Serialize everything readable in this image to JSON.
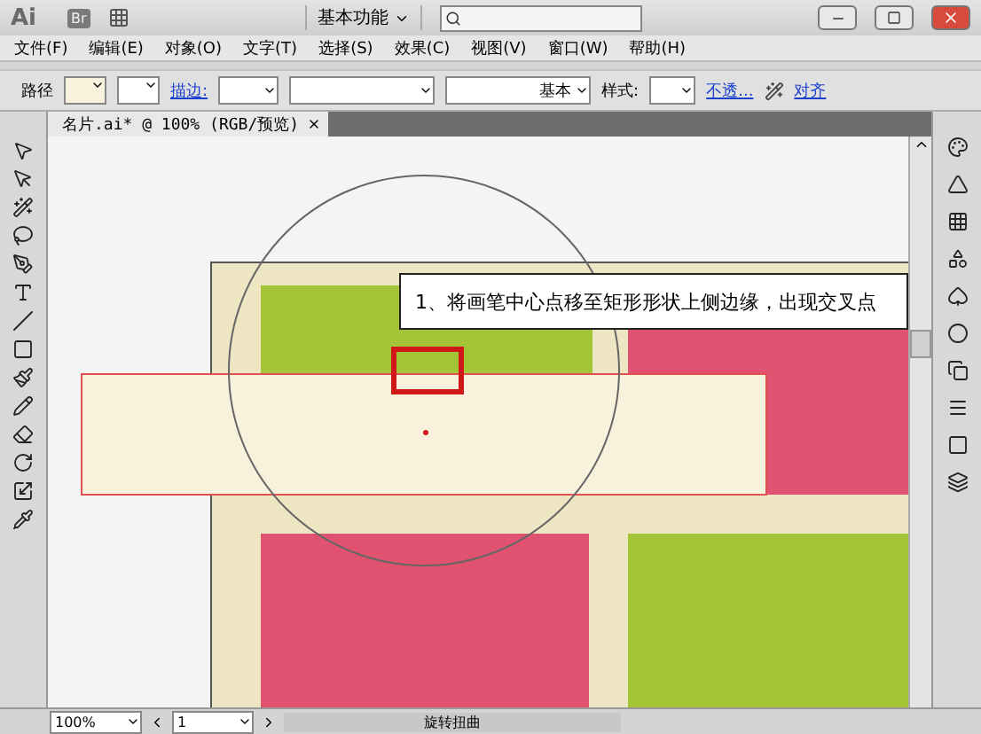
{
  "title_bar": {
    "app_logo": "Ai",
    "bridge": "Br",
    "workspace": "基本功能"
  },
  "menu": [
    "文件(F)",
    "编辑(E)",
    "对象(O)",
    "文字(T)",
    "选择(S)",
    "效果(C)",
    "视图(V)",
    "窗口(W)",
    "帮助(H)"
  ],
  "control_bar": {
    "selection": "路径",
    "stroke_label": "描边:",
    "brush": "基本",
    "style_label": "样式:",
    "opacity_link": "不透...",
    "align_link": "对齐"
  },
  "document_tab": {
    "title": "名片.ai* @ 100% (RGB/预览)"
  },
  "callout": {
    "text": "1、将画笔中心点移至矩形形状上侧边缘，出现交叉点"
  },
  "status_bar": {
    "zoom": "100%",
    "page": "1",
    "tool": "旋转扭曲"
  }
}
